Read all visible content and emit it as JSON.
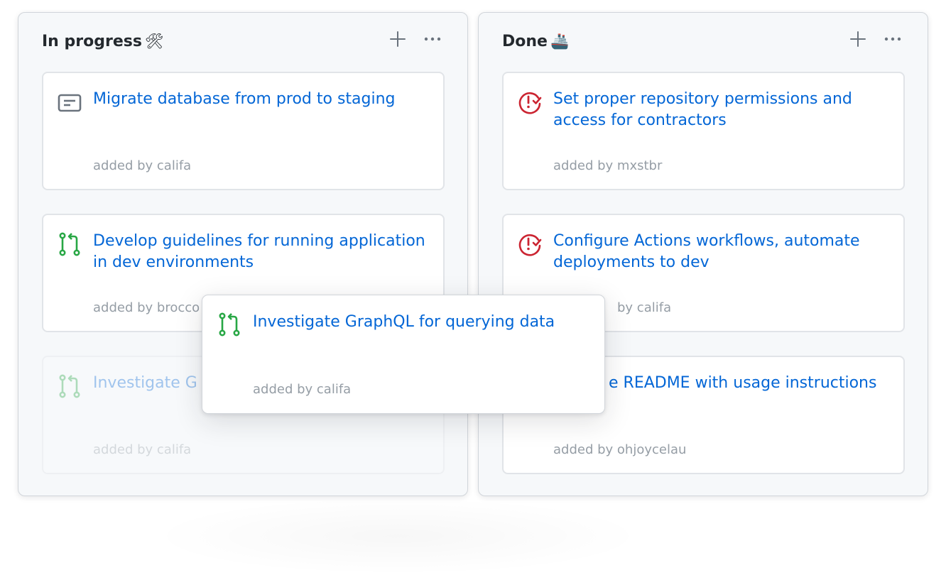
{
  "columns": [
    {
      "title": "In progress",
      "emoji": "🛠",
      "cards": [
        {
          "title": "Migrate database from prod to staging",
          "meta": "added by califa",
          "icon": "note-icon"
        },
        {
          "title": "Develop guidelines for running application in dev environments",
          "meta": "added by brocco",
          "icon": "pull-request-icon"
        },
        {
          "title": "Investigate G",
          "meta": "added by califa",
          "icon": "pull-request-icon",
          "placeholder": true
        }
      ]
    },
    {
      "title": "Done",
      "emoji": "🚢",
      "cards": [
        {
          "title": "Set proper repository permissions and access for contractors",
          "meta": "added by mxstbr",
          "icon": "issue-closed-icon"
        },
        {
          "title": "Configure Actions workflows, automate deployments to dev",
          "meta": "by califa",
          "icon": "issue-closed-icon"
        },
        {
          "title": "e README with usage instructions",
          "meta": "added by ohjoycelau",
          "icon": "issue-closed-icon"
        }
      ]
    }
  ],
  "dragging_card": {
    "title": "Investigate GraphQL for querying data",
    "meta": "added by califa",
    "icon": "pull-request-icon"
  },
  "colors": {
    "link": "#0366d6",
    "muted": "#959da5",
    "green": "#28a745",
    "red": "#cb2431",
    "gray_icon": "#6a737d"
  }
}
